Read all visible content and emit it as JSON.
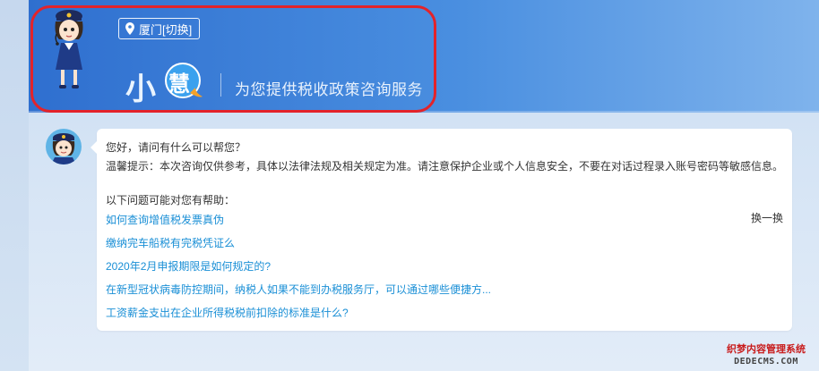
{
  "header": {
    "location_label": "厦门[切换]",
    "brand_part1": "小",
    "brand_part2": "慧",
    "tagline": "为您提供税收政策咨询服务"
  },
  "chat": {
    "greeting": "您好，请问有什么可以帮您？",
    "tip": "温馨提示：本次咨询仅供参考，具体以法律法规及相关规定为准。请注意保护企业或个人信息安全，不要在对话过程录入账号密码等敏感信息。",
    "suggest_title": "以下问题可能对您有帮助：",
    "refresh_label": "换一换",
    "questions": [
      "如何查询增值税发票真伪",
      "缴纳完车船税有完税凭证么",
      "2020年2月申报期限是如何规定的?",
      "在新型冠状病毒防控期间，纳税人如果不能到办税服务厅，可以通过哪些便捷方...",
      "工资薪金支出在企业所得税税前扣除的标准是什么?"
    ]
  },
  "watermark": {
    "line1": "织梦内容管理系统",
    "line2": "DEDECMS.COM"
  },
  "colors": {
    "header_blue": "#2f6fcf",
    "link_blue": "#1a8fd6",
    "highlight_red": "#e3232a"
  }
}
